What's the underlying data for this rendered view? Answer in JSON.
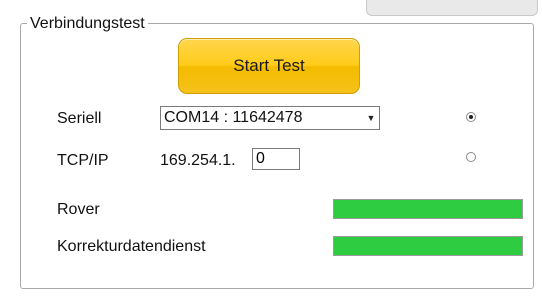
{
  "group": {
    "title": "Verbindungstest"
  },
  "start_button": {
    "label": "Start Test"
  },
  "serial": {
    "label": "Seriell",
    "selected_port": "COM14 : 11642478",
    "radio_selected": true
  },
  "tcpip": {
    "label": "TCP/IP",
    "ip_prefix": "169.254.1.",
    "ip_last_octet": "0",
    "radio_selected": false
  },
  "status_rows": [
    {
      "label": "Rover",
      "progress": 1.0,
      "color": "#2ecc40"
    },
    {
      "label": "Korrekturdatendienst",
      "progress": 1.0,
      "color": "#2ecc40"
    }
  ],
  "icons": {
    "dropdown": "chevron-down-icon"
  }
}
